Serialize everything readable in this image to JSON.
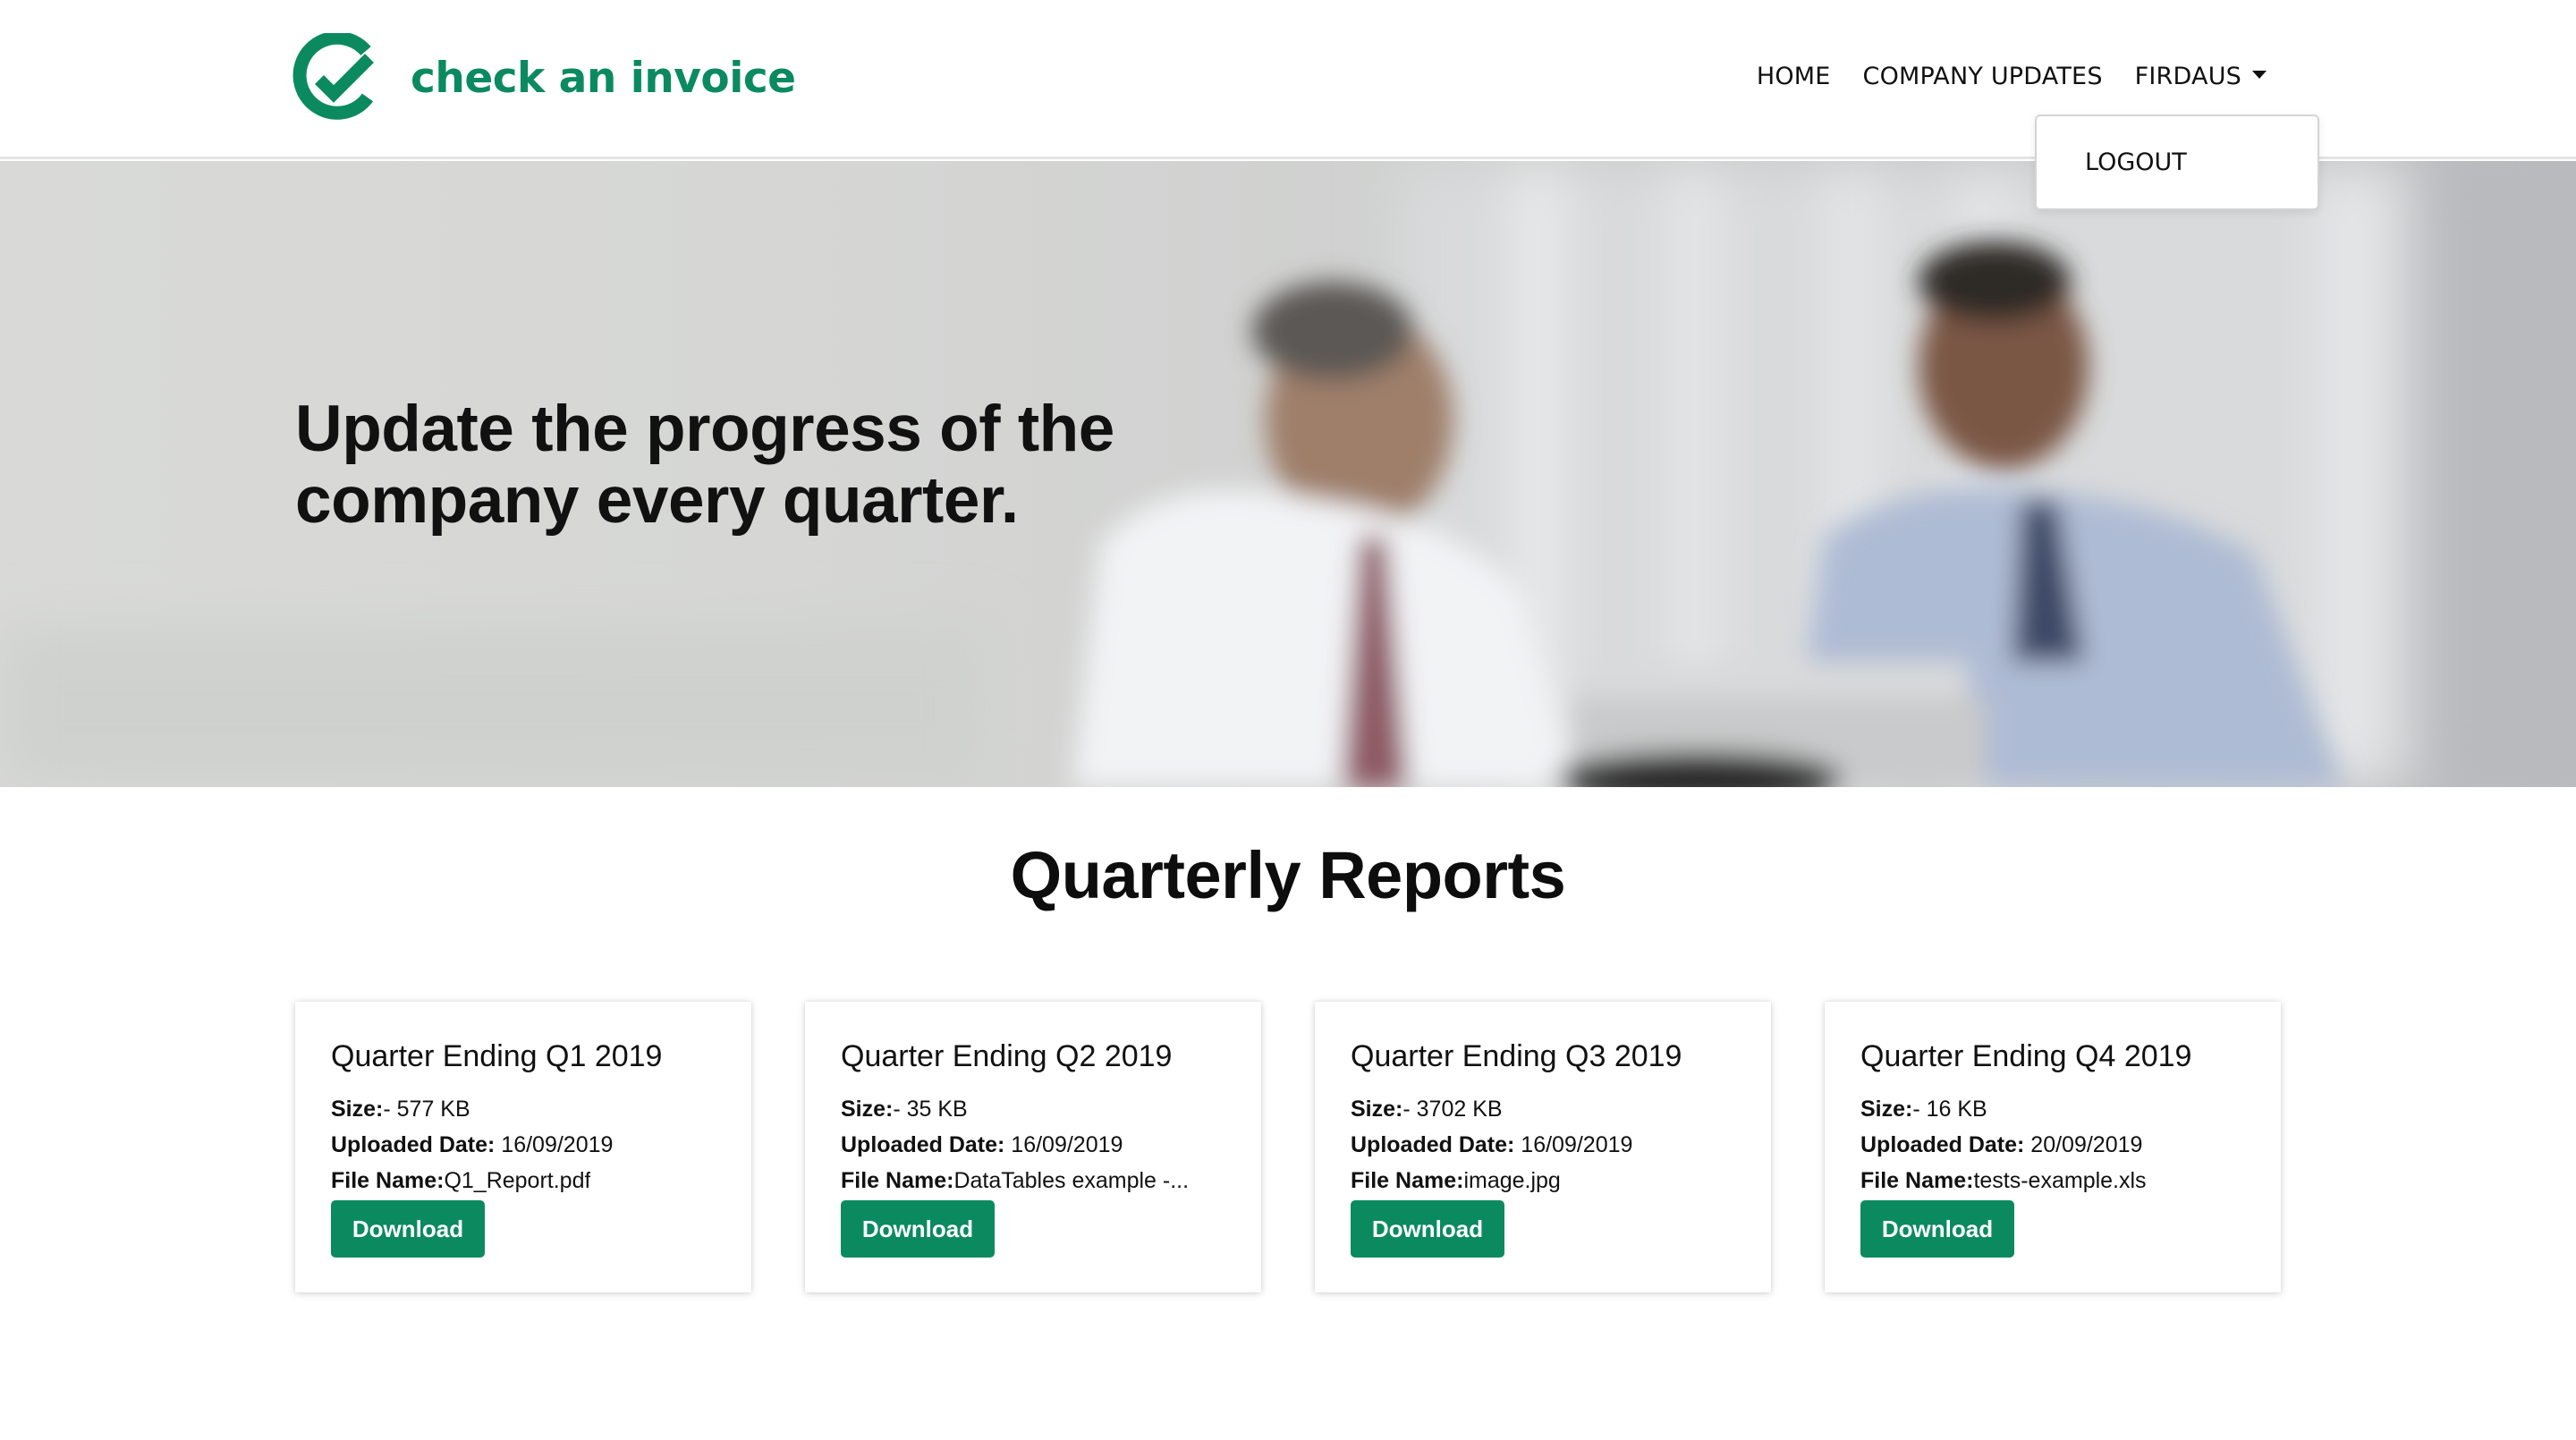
{
  "header": {
    "brand": "check an invoice",
    "brand_color": "#0b8a60",
    "nav": {
      "home": "HOME",
      "updates": "COMPANY UPDATES",
      "user": "FIRDAUS"
    },
    "dropdown": {
      "logout": "LOGOUT"
    }
  },
  "hero": {
    "title_line1": "Update the progress of the",
    "title_line2": "company every quarter."
  },
  "section": {
    "title": "Quarterly Reports"
  },
  "labels": {
    "size": "Size:",
    "uploaded": "Uploaded Date:",
    "file": "File Name:"
  },
  "cards": [
    {
      "title": "Quarter Ending Q1 2019",
      "size": "- 577 KB",
      "date": " 16/09/2019",
      "file": "Q1_Report.pdf",
      "button": "Download"
    },
    {
      "title": "Quarter Ending Q2 2019",
      "size": "- 35 KB",
      "date": " 16/09/2019",
      "file": "DataTables example -...",
      "button": "Download"
    },
    {
      "title": "Quarter Ending Q3 2019",
      "size": "- 3702 KB",
      "date": " 16/09/2019",
      "file": "image.jpg",
      "button": "Download"
    },
    {
      "title": "Quarter Ending Q4 2019",
      "size": "- 16 KB",
      "date": " 20/09/2019",
      "file": "tests-example.xls",
      "button": "Download"
    }
  ]
}
